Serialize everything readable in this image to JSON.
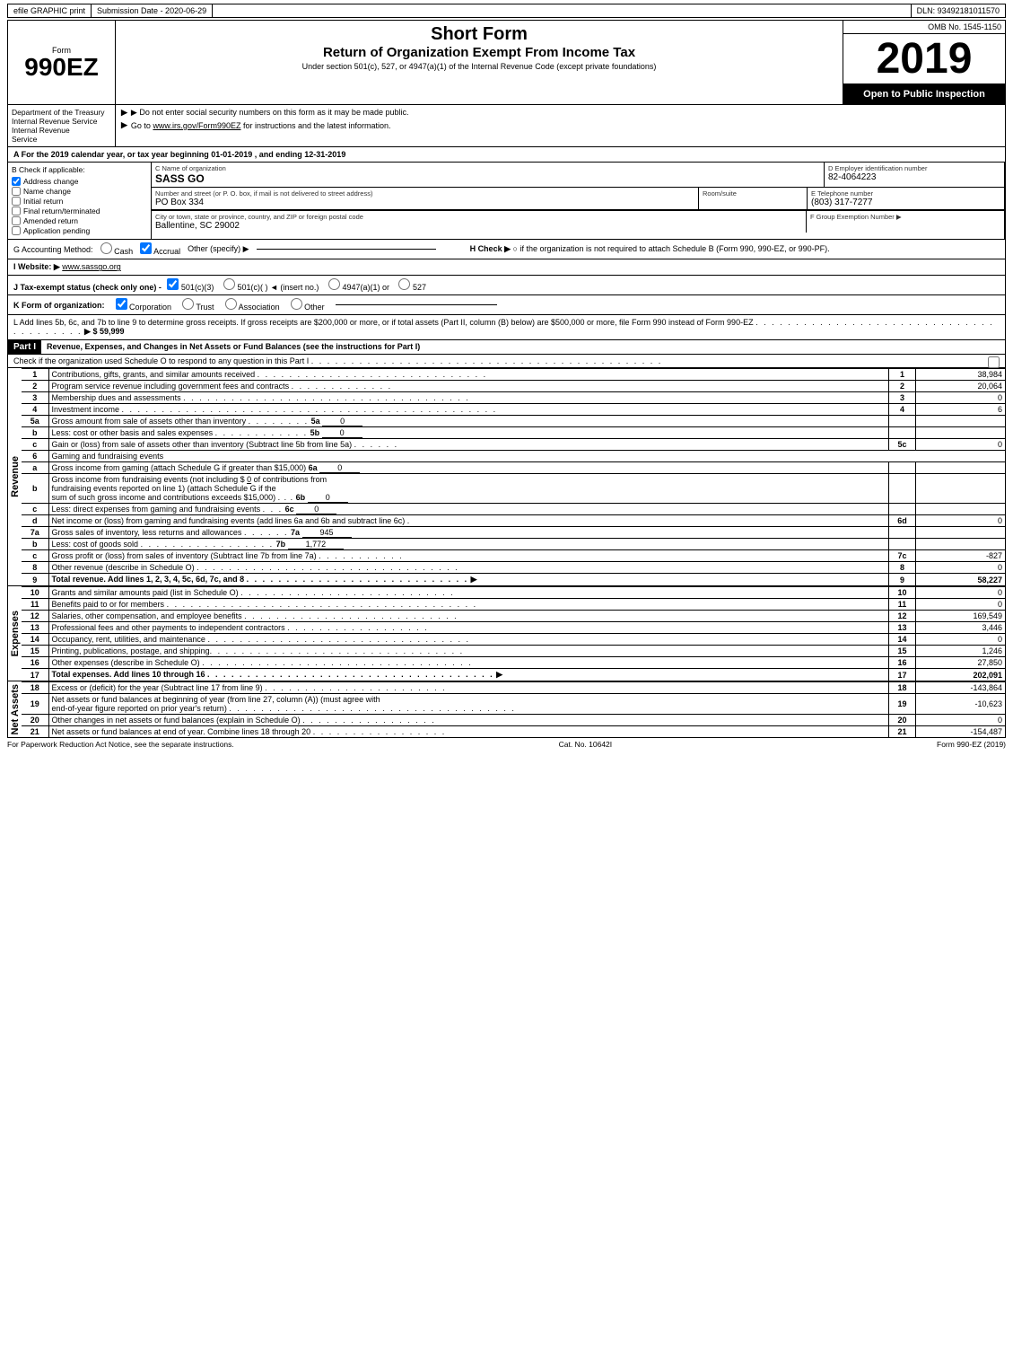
{
  "topBar": {
    "efile": "efile GRAPHIC print",
    "submission": "Submission Date - 2020-06-29",
    "dln": "DLN: 93492181011570"
  },
  "header": {
    "formLabel": "Form",
    "formNumber": "990EZ",
    "shortForm": "Short Form",
    "returnTitle": "Return of Organization Exempt From Income Tax",
    "underSection": "Under section 501(c), 527, or 4947(a)(1) of the Internal Revenue Code (except private foundations)",
    "doNotEnter": "▶ Do not enter social security numbers on this form as it may be made public.",
    "goTo": "▶ Go to www.irs.gov/Form990EZ for instructions and the latest information.",
    "ombLabel": "OMB No. 1545-1150",
    "year": "2019",
    "openToPublic": "Open to Public Inspection"
  },
  "dept": {
    "line1": "Department of the Treasury",
    "line2": "Internal Revenue Service"
  },
  "sectionA": {
    "text": "A  For the 2019 calendar year, or tax year beginning 01-01-2019 , and ending 12-31-2019"
  },
  "sectionB": {
    "label": "B  Check if applicable:",
    "addressChange": "Address change",
    "nameChange": "Name change",
    "initialReturn": "Initial return",
    "finalReturn": "Final return/terminated",
    "amendedReturn": "Amended return",
    "applicationPending": "Application pending",
    "addressChecked": true,
    "nameChecked": false
  },
  "orgInfo": {
    "cLabel": "C Name of organization",
    "orgName": "SASS GO",
    "dLabel": "D Employer identification number",
    "ein": "82-4064223",
    "addressLabel": "Number and street (or P. O. box, if mail is not delivered to street address)",
    "address": "PO Box 334",
    "roomSuiteLabel": "Room/suite",
    "roomSuite": "",
    "eLabel": "E Telephone number",
    "phone": "(803) 317-7277",
    "cityLabel": "City or town, state or province, country, and ZIP or foreign postal code",
    "city": "Ballentine, SC  29002",
    "fLabel": "F Group Exemption Number",
    "groupNum": ""
  },
  "accounting": {
    "gLabel": "G Accounting Method:",
    "cash": "Cash",
    "accrual": "Accrual",
    "accrualChecked": true,
    "otherSpecify": "Other (specify) ▶",
    "hLabel": "H  Check ▶",
    "hText": "○ if the organization is not required to attach Schedule B (Form 990, 990-EZ, or 990-PF)."
  },
  "website": {
    "iLabel": "I Website: ▶",
    "url": "www.sassgo.org"
  },
  "taxStatus": {
    "jLabel": "J Tax-exempt status (check only one) -",
    "options": [
      "✔ 501(c)(3)",
      "○ 501(c)(",
      ") ◄ (insert no.)",
      "○ 4947(a)(1) or",
      "○ 527"
    ]
  },
  "formOrg": {
    "kLabel": "K Form of organization:",
    "corporation": "Corporation",
    "trust": "Trust",
    "association": "Association",
    "other": "Other",
    "corporationChecked": true
  },
  "lRow": {
    "text": "L Add lines 5b, 6c, and 7b to line 9 to determine gross receipts. If gross receipts are $200,000 or more, or if total assets (Part II, column (B) below) are $500,000 or more, file Form 990 instead of Form 990-EZ",
    "amount": "$ 59,999"
  },
  "partI": {
    "label": "Part I",
    "title": "Revenue, Expenses, and Changes in Net Assets or Fund Balances (see the instructions for Part I)",
    "scheduleO": "Check if the organization used Schedule O to respond to any question in this Part I",
    "lines": [
      {
        "num": "1",
        "desc": "Contributions, gifts, grants, and similar amounts received",
        "value": "38,984"
      },
      {
        "num": "2",
        "desc": "Program service revenue including government fees and contracts",
        "value": "20,064"
      },
      {
        "num": "3",
        "desc": "Membership dues and assessments",
        "value": "0"
      },
      {
        "num": "4",
        "desc": "Investment income",
        "value": "6"
      },
      {
        "num": "5a",
        "desc": "Gross amount from sale of assets other than inventory",
        "ref": "5a",
        "refVal": "0",
        "value": ""
      },
      {
        "num": "b",
        "desc": "Less: cost or other basis and sales expenses",
        "ref": "5b",
        "refVal": "0",
        "value": ""
      },
      {
        "num": "c",
        "desc": "Gain or (loss) from sale of assets other than inventory (Subtract line 5b from line 5a)",
        "ref": "5c",
        "value": "0"
      },
      {
        "num": "6",
        "desc": "Gaming and fundraising events",
        "value": ""
      },
      {
        "num": "a",
        "desc": "Gross income from gaming (attach Schedule G if greater than $15,000)",
        "ref": "6a",
        "refVal": "0",
        "value": ""
      },
      {
        "num": "b",
        "desc": "Gross income from fundraising events (not including $ 0 of contributions from fundraising events reported on line 1) (attach Schedule G if the sum of such gross income and contributions exceeds $15,000)",
        "ref": "6b",
        "refVal": "0",
        "value": ""
      },
      {
        "num": "c",
        "desc": "Less: direct expenses from gaming and fundraising events",
        "ref": "6c",
        "refVal": "0",
        "value": ""
      },
      {
        "num": "d",
        "desc": "Net income or (loss) from gaming and fundraising events (add lines 6a and 6b and subtract line 6c)",
        "ref": "6d",
        "value": "0"
      },
      {
        "num": "7a",
        "desc": "Gross sales of inventory, less returns and allowances",
        "ref": "7a",
        "refVal": "945",
        "value": ""
      },
      {
        "num": "b",
        "desc": "Less: cost of goods sold",
        "ref": "7b",
        "refVal": "1,772",
        "value": ""
      },
      {
        "num": "c",
        "desc": "Gross profit or (loss) from sales of inventory (Subtract line 7b from line 7a)",
        "ref": "7c",
        "value": "-827"
      },
      {
        "num": "8",
        "desc": "Other revenue (describe in Schedule O)",
        "value": "0"
      },
      {
        "num": "9",
        "desc": "Total revenue. Add lines 1, 2, 3, 4, 5c, 6d, 7c, and 8",
        "value": "58,227",
        "bold": true
      }
    ],
    "expenseLines": [
      {
        "num": "10",
        "desc": "Grants and similar amounts paid (list in Schedule O)",
        "value": "0"
      },
      {
        "num": "11",
        "desc": "Benefits paid to or for members",
        "value": "0"
      },
      {
        "num": "12",
        "desc": "Salaries, other compensation, and employee benefits",
        "value": "169,549"
      },
      {
        "num": "13",
        "desc": "Professional fees and other payments to independent contractors",
        "value": "3,446"
      },
      {
        "num": "14",
        "desc": "Occupancy, rent, utilities, and maintenance",
        "value": "0"
      },
      {
        "num": "15",
        "desc": "Printing, publications, postage, and shipping",
        "value": "1,246"
      },
      {
        "num": "16",
        "desc": "Other expenses (describe in Schedule O)",
        "value": "27,850"
      },
      {
        "num": "17",
        "desc": "Total expenses. Add lines 10 through 16",
        "value": "202,091",
        "bold": true
      }
    ],
    "netAssetLines": [
      {
        "num": "18",
        "desc": "Excess or (deficit) for the year (Subtract line 17 from line 9)",
        "value": "-143,864"
      },
      {
        "num": "19",
        "desc": "Net assets or fund balances at beginning of year (from line 27, column (A)) (must agree with end-of-year figure reported on prior year's return)",
        "value": "-10,623"
      },
      {
        "num": "20",
        "desc": "Other changes in net assets or fund balances (explain in Schedule O)",
        "value": "0"
      },
      {
        "num": "21",
        "desc": "Net assets or fund balances at end of year. Combine lines 18 through 20",
        "value": "-154,487"
      }
    ]
  },
  "footer": {
    "paperwork": "For Paperwork Reduction Act Notice, see the separate instructions.",
    "catNo": "Cat. No. 10642I",
    "formRef": "Form 990-EZ (2019)"
  }
}
